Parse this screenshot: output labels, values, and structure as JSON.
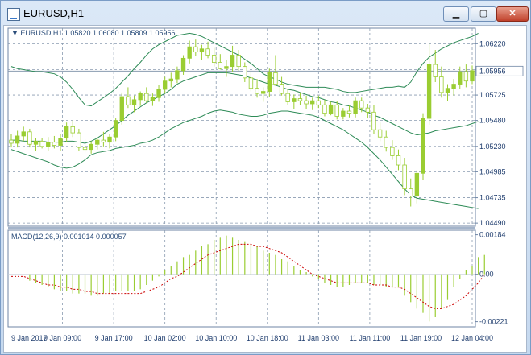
{
  "window": {
    "title": "EURUSD,H1",
    "minimize_label": "▁",
    "maximize_label": "▢",
    "close_label": "✕"
  },
  "chart_data": {
    "type": "candlestick",
    "symbol_info": "▼ EURUSD,H1  1.05820 1.06080 1.05809 1.05956",
    "price_axis": {
      "ticks": [
        1.0622,
        1.0597,
        1.05725,
        1.0548,
        1.0523,
        1.04985,
        1.04735,
        1.0449
      ],
      "tick_labels": [
        "1.06220",
        "1.05956",
        "1.05725",
        "1.05480",
        "1.05230",
        "1.04985",
        "1.04735",
        "1.04490"
      ],
      "current_price_label": "1.05956",
      "current_price": 1.05956,
      "range": [
        1.0446,
        1.0637
      ]
    },
    "time_axis": {
      "tick_labels": [
        "9 Jan 2017",
        "9 Jan 09:00",
        "9 Jan 17:00",
        "10 Jan 02:00",
        "10 Jan 10:00",
        "10 Jan 18:00",
        "11 Jan 03:00",
        "11 Jan 11:00",
        "11 Jan 19:00",
        "12 Jan 04:00"
      ]
    },
    "candles_ohlc": [
      [
        1.0529,
        1.0535,
        1.0522,
        1.0526
      ],
      [
        1.0526,
        1.0538,
        1.0522,
        1.0533
      ],
      [
        1.0533,
        1.0542,
        1.0528,
        1.0537
      ],
      [
        1.0537,
        1.054,
        1.0522,
        1.0525
      ],
      [
        1.0525,
        1.0531,
        1.0519,
        1.0528
      ],
      [
        1.0528,
        1.0531,
        1.0521,
        1.0523
      ],
      [
        1.0523,
        1.0532,
        1.0519,
        1.0527
      ],
      [
        1.0527,
        1.0533,
        1.0521,
        1.0524
      ],
      [
        1.0524,
        1.0535,
        1.0519,
        1.0531
      ],
      [
        1.0531,
        1.0546,
        1.0527,
        1.0542
      ],
      [
        1.0542,
        1.0548,
        1.0532,
        1.0536
      ],
      [
        1.0536,
        1.054,
        1.0519,
        1.0522
      ],
      [
        1.0522,
        1.053,
        1.0517,
        1.052
      ],
      [
        1.052,
        1.0528,
        1.0516,
        1.0525
      ],
      [
        1.0525,
        1.0531,
        1.052,
        1.0529
      ],
      [
        1.0529,
        1.0537,
        1.0523,
        1.0527
      ],
      [
        1.0527,
        1.0535,
        1.0521,
        1.0532
      ],
      [
        1.0532,
        1.055,
        1.0528,
        1.0548
      ],
      [
        1.0548,
        1.0575,
        1.0544,
        1.0571
      ],
      [
        1.0571,
        1.058,
        1.056,
        1.0563
      ],
      [
        1.0563,
        1.0572,
        1.0556,
        1.0568
      ],
      [
        1.0568,
        1.0576,
        1.0562,
        1.0574
      ],
      [
        1.0574,
        1.058,
        1.0565,
        1.0567
      ],
      [
        1.0567,
        1.0574,
        1.0562,
        1.057
      ],
      [
        1.057,
        1.0582,
        1.0566,
        1.0578
      ],
      [
        1.0578,
        1.059,
        1.0574,
        1.0586
      ],
      [
        1.0586,
        1.0594,
        1.058,
        1.0588
      ],
      [
        1.0588,
        1.06,
        1.0584,
        1.0596
      ],
      [
        1.0596,
        1.0611,
        1.0592,
        1.0608
      ],
      [
        1.0608,
        1.0625,
        1.0603,
        1.0619
      ],
      [
        1.0619,
        1.0626,
        1.061,
        1.0614
      ],
      [
        1.0614,
        1.0621,
        1.0606,
        1.0617
      ],
      [
        1.0617,
        1.0624,
        1.0608,
        1.0611
      ],
      [
        1.0611,
        1.0618,
        1.06,
        1.0604
      ],
      [
        1.0604,
        1.0612,
        1.0597,
        1.0598
      ],
      [
        1.0598,
        1.0606,
        1.059,
        1.06
      ],
      [
        1.06,
        1.062,
        1.0595,
        1.0611
      ],
      [
        1.0611,
        1.0616,
        1.0596,
        1.06
      ],
      [
        1.06,
        1.0604,
        1.0585,
        1.0589
      ],
      [
        1.0589,
        1.0595,
        1.0576,
        1.0579
      ],
      [
        1.0579,
        1.0588,
        1.057,
        1.0574
      ],
      [
        1.0574,
        1.058,
        1.0566,
        1.0576
      ],
      [
        1.0576,
        1.0598,
        1.0571,
        1.0594
      ],
      [
        1.0594,
        1.0611,
        1.0585,
        1.0583
      ],
      [
        1.0583,
        1.059,
        1.0572,
        1.0574
      ],
      [
        1.0574,
        1.0578,
        1.0563,
        1.0566
      ],
      [
        1.0566,
        1.0573,
        1.0559,
        1.0569
      ],
      [
        1.0569,
        1.0575,
        1.0563,
        1.0567
      ],
      [
        1.0567,
        1.0572,
        1.0559,
        1.0564
      ],
      [
        1.0564,
        1.057,
        1.0558,
        1.0567
      ],
      [
        1.0567,
        1.0572,
        1.056,
        1.0563
      ],
      [
        1.0563,
        1.0568,
        1.0552,
        1.0555
      ],
      [
        1.0555,
        1.0566,
        1.0553,
        1.0563
      ],
      [
        1.0563,
        1.0567,
        1.0549,
        1.0552
      ],
      [
        1.0552,
        1.056,
        1.0549,
        1.0557
      ],
      [
        1.0557,
        1.0563,
        1.0551,
        1.0555
      ],
      [
        1.0555,
        1.057,
        1.0551,
        1.0567
      ],
      [
        1.0567,
        1.057,
        1.0556,
        1.056
      ],
      [
        1.056,
        1.0564,
        1.055,
        1.0556
      ],
      [
        1.0556,
        1.0563,
        1.0535,
        1.0539
      ],
      [
        1.0539,
        1.0546,
        1.0528,
        1.0532
      ],
      [
        1.0532,
        1.0538,
        1.0518,
        1.0522
      ],
      [
        1.0522,
        1.0529,
        1.051,
        1.0514
      ],
      [
        1.0514,
        1.052,
        1.05,
        1.0505
      ],
      [
        1.0505,
        1.0512,
        1.0476,
        1.0482
      ],
      [
        1.0482,
        1.0492,
        1.0465,
        1.0475
      ],
      [
        1.0475,
        1.05,
        1.0468,
        1.0497
      ],
      [
        1.0497,
        1.0555,
        1.0491,
        1.055
      ],
      [
        1.055,
        1.0622,
        1.0544,
        1.0602
      ],
      [
        1.0602,
        1.0616,
        1.0585,
        1.059
      ],
      [
        1.059,
        1.06,
        1.057,
        1.0575
      ],
      [
        1.0575,
        1.0583,
        1.0567,
        1.0579
      ],
      [
        1.0579,
        1.0588,
        1.0572,
        1.0583
      ],
      [
        1.0583,
        1.06,
        1.0578,
        1.0595
      ],
      [
        1.0595,
        1.0602,
        1.058,
        1.0586
      ],
      [
        1.0586,
        1.0601,
        1.0583,
        1.0596
      ]
    ],
    "bollinger": {
      "upper": [
        1.06,
        1.0598,
        1.0597,
        1.0596,
        1.0595,
        1.0595,
        1.0594,
        1.0593,
        1.059,
        1.0585,
        1.0578,
        1.057,
        1.0563,
        1.0562,
        1.0566,
        1.057,
        1.0574,
        1.0579,
        1.0585,
        1.0591,
        1.0598,
        1.0604,
        1.0611,
        1.0617,
        1.0621,
        1.0624,
        1.0627,
        1.063,
        1.0631,
        1.0632,
        1.0631,
        1.0629,
        1.0626,
        1.0623,
        1.062,
        1.0617,
        1.0614,
        1.0611,
        1.0607,
        1.0603,
        1.0598,
        1.0593,
        1.059,
        1.0588,
        1.0585,
        1.0583,
        1.0582,
        1.0581,
        1.058,
        1.058,
        1.058,
        1.058,
        1.0579,
        1.0578,
        1.0576,
        1.0575,
        1.0575,
        1.0576,
        1.0577,
        1.0578,
        1.0579,
        1.058,
        1.058,
        1.0581,
        1.058,
        1.0585,
        1.0595,
        1.0603,
        1.0609,
        1.0613,
        1.0617,
        1.062,
        1.0623,
        1.0625,
        1.0627,
        1.0629,
        1.0632
      ],
      "middle": [
        1.0529,
        1.0529,
        1.0528,
        1.0528,
        1.0528,
        1.0528,
        1.0527,
        1.0527,
        1.0527,
        1.0528,
        1.0528,
        1.0527,
        1.0526,
        1.0528,
        1.0531,
        1.0535,
        1.0539,
        1.0543,
        1.0548,
        1.0553,
        1.0557,
        1.0561,
        1.0565,
        1.0568,
        1.0571,
        1.0574,
        1.0578,
        1.0583,
        1.0586,
        1.0588,
        1.059,
        1.0592,
        1.0594,
        1.0594,
        1.0594,
        1.0594,
        1.0593,
        1.0592,
        1.0591,
        1.0589,
        1.0587,
        1.0585,
        1.0583,
        1.0582,
        1.058,
        1.0578,
        1.0577,
        1.0575,
        1.0573,
        1.0571,
        1.057,
        1.0568,
        1.0566,
        1.0565,
        1.0563,
        1.0562,
        1.056,
        1.0558,
        1.0556,
        1.0553,
        1.0551,
        1.0548,
        1.0545,
        1.0542,
        1.0539,
        1.0536,
        1.0534,
        1.0535,
        1.0536,
        1.0538,
        1.0539,
        1.054,
        1.0541,
        1.0542,
        1.0543,
        1.0545,
        1.0547
      ],
      "lower": [
        1.052,
        1.0518,
        1.0516,
        1.0514,
        1.0512,
        1.051,
        1.0508,
        1.0505,
        1.0503,
        1.0502,
        1.0503,
        1.0506,
        1.051,
        1.0515,
        1.0517,
        1.0518,
        1.0519,
        1.0521,
        1.0522,
        1.0523,
        1.0524,
        1.0526,
        1.0527,
        1.0529,
        1.0532,
        1.0536,
        1.054,
        1.0543,
        1.0546,
        1.0548,
        1.055,
        1.0552,
        1.0555,
        1.0557,
        1.0558,
        1.0557,
        1.0556,
        1.0554,
        1.0553,
        1.0552,
        1.0552,
        1.0553,
        1.0555,
        1.0556,
        1.0557,
        1.0557,
        1.0556,
        1.0555,
        1.0554,
        1.0553,
        1.0551,
        1.0548,
        1.0545,
        1.0542,
        1.0539,
        1.0535,
        1.0531,
        1.0527,
        1.0522,
        1.0516,
        1.051,
        1.0503,
        1.0496,
        1.0489,
        1.0482,
        1.0476,
        1.0473,
        1.0472,
        1.0471,
        1.047,
        1.0469,
        1.0468,
        1.0467,
        1.0466,
        1.0465,
        1.0464,
        1.0463
      ]
    },
    "macd": {
      "label": "MACD(12,26,9) 0.001014 0.000057",
      "axis_ticks": [
        0.00184,
        0.0,
        -0.00221
      ],
      "axis_tick_labels": [
        "0.00184",
        "0.00",
        "-0.00221"
      ],
      "range": [
        -0.00245,
        0.00205
      ],
      "histogram": [
        0.0,
        0.0,
        0.0,
        -0.0003,
        -0.0004,
        -0.0005,
        -0.0006,
        -0.0007,
        -0.0008,
        -0.0008,
        -0.0009,
        -0.0009,
        -0.0009,
        -0.001,
        -0.001,
        -0.0009,
        -0.0009,
        -0.0008,
        -0.0008,
        -0.0008,
        -0.0008,
        -0.0007,
        -0.0005,
        -0.0003,
        -0.0001,
        0.0002,
        0.0004,
        0.0006,
        0.0008,
        0.0009,
        0.0011,
        0.0013,
        0.0014,
        0.0016,
        0.0017,
        0.0018,
        0.0017,
        0.0016,
        0.0015,
        0.0014,
        0.0013,
        0.0011,
        0.001,
        0.0009,
        0.0007,
        0.0006,
        0.0004,
        0.0002,
        0.0001,
        -0.0001,
        -0.0002,
        -0.0004,
        -0.0005,
        -0.0006,
        -0.0006,
        -0.0005,
        -0.0004,
        -0.0004,
        -0.0004,
        -0.0005,
        -0.0005,
        -0.0006,
        -0.0006,
        -0.0006,
        -0.001,
        -0.0013,
        -0.0016,
        -0.0018,
        -0.0022,
        -0.002,
        -0.0016,
        -0.0012,
        -0.0006,
        -0.0002,
        0.0002,
        0.0004,
        0.0008,
        0.0009
      ],
      "signal": [
        -0.0001,
        -0.0001,
        -0.0001,
        -0.0002,
        -0.0003,
        -0.0004,
        -0.0005,
        -0.0005,
        -0.0006,
        -0.0006,
        -0.0007,
        -0.0007,
        -0.0008,
        -0.0008,
        -0.0009,
        -0.0009,
        -0.0009,
        -0.0009,
        -0.0009,
        -0.0009,
        -0.0009,
        -0.0009,
        -0.0008,
        -0.0007,
        -0.0006,
        -0.0004,
        -0.0002,
        -0.0001,
        0.0001,
        0.0003,
        0.0005,
        0.0007,
        0.0009,
        0.001,
        0.0011,
        0.0012,
        0.0013,
        0.0014,
        0.0014,
        0.0014,
        0.0013,
        0.0013,
        0.0012,
        0.0011,
        0.001,
        0.0008,
        0.0006,
        0.0004,
        0.0002,
        0.0,
        -0.0001,
        -0.0002,
        -0.0003,
        -0.0004,
        -0.0004,
        -0.0004,
        -0.0004,
        -0.0004,
        -0.0004,
        -0.0005,
        -0.0005,
        -0.0005,
        -0.0006,
        -0.0006,
        -0.0007,
        -0.0009,
        -0.0011,
        -0.0013,
        -0.0015,
        -0.0016,
        -0.0016,
        -0.0015,
        -0.0014,
        -0.0012,
        -0.001,
        -0.0007,
        -0.0004,
        0.0
      ]
    },
    "colors": {
      "candle": "#9acd32",
      "bands": "#2e8b57",
      "grid": "#8a9bb0",
      "axis_text": "#1f3d6e",
      "signal": "#cc0000",
      "current_price_line": "#8a9bb0"
    },
    "grid": true
  }
}
